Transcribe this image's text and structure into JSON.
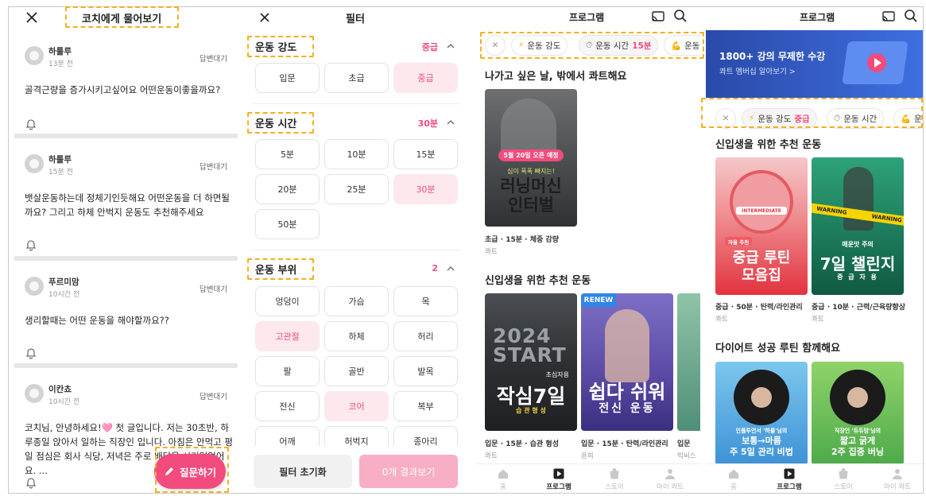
{
  "panel1": {
    "title": "코치에게 물어보기",
    "questions": [
      {
        "name": "하룰루",
        "time": "13분 전",
        "status": "답변대기",
        "text": "골격근량을 증가시키고싶어요 어떤운동이좋을까요?"
      },
      {
        "name": "하룰루",
        "time": "15분 전",
        "status": "답변대기",
        "text": "뱃살운동하는데 정체기인듯해요 어떤운동을 더 하면될까요? 그리고 하체 안벅지 운동도 추천해주세요"
      },
      {
        "name": "푸르미맘",
        "time": "10시간 전",
        "status": "답변대기",
        "text": "생리할때는 어떤 운동을 해야할까요??"
      },
      {
        "name": "이칸쵸",
        "time": "10시간 전",
        "status": "답변대기",
        "text": "코치님, 안녕하세요!🩷 첫 글입니다. 저는 30초반, 하루종일 앉아서 일하는 직장인 입니다. 아침은 안먹고 평일 점심은 회사 식당, 저녁은 주로 배달을 시켜먹었어요. ..."
      }
    ],
    "ask_button": "질문하기"
  },
  "panel2": {
    "title": "필터",
    "sections": [
      {
        "title": "운동 강도",
        "value": "중급",
        "options": [
          "입문",
          "초급",
          "중급"
        ],
        "selected": [
          "중급"
        ]
      },
      {
        "title": "운동 시간",
        "value": "30분",
        "options": [
          "5분",
          "10분",
          "15분",
          "20분",
          "25분",
          "30분",
          "50분"
        ],
        "selected": [
          "30분"
        ]
      },
      {
        "title": "운동 부위",
        "value": "2",
        "options": [
          "엉덩이",
          "가슴",
          "목",
          "고관절",
          "하체",
          "허리",
          "팔",
          "골반",
          "발목",
          "전신",
          "코어",
          "복부",
          "어깨",
          "허벅지",
          "종아리"
        ],
        "selected": [
          "고관절",
          "코어"
        ]
      }
    ],
    "reset_button": "필터 초기화",
    "result_button": "0개 결과보기"
  },
  "panel3": {
    "title": "프로그램",
    "pills": [
      {
        "icon": "lightning-icon",
        "label": "운동 강도",
        "value": ""
      },
      {
        "icon": "timer-icon",
        "label": "운동 시간",
        "value": "15분"
      },
      {
        "icon": "muscle-icon",
        "label": "운동",
        "value": ""
      }
    ],
    "section1": {
      "title": "나가고 싶은 날, 밖에서 콰트해요",
      "card": {
        "badge": "5월 20일 오픈 예정",
        "kicker": "심이 폭폭 빠지는!",
        "big": "러닝머신\n인터벌",
        "caption": "초급 · 15분 · 체중 감량",
        "sub": "콰트"
      }
    },
    "section2": {
      "title": "신입생을 위한 추천 운동",
      "cards": [
        {
          "top": "2024\nSTART",
          "kicker": "초심자용",
          "big": "작심7일",
          "small": "습 관 형 성",
          "caption": "입문 · 15분 · 습관 형성",
          "sub": "콰트"
        },
        {
          "badge": "RENEW",
          "big": "쉽다 쉬워",
          "small": "전신 운동",
          "caption": "입문 · 15분 · 탄력/라인관리",
          "sub": "윤희"
        },
        {
          "caption": "입문",
          "sub": "빅씨스"
        }
      ]
    },
    "nav": [
      "홈",
      "프로그램",
      "스토어",
      "마이 콰트"
    ]
  },
  "panel4": {
    "title": "프로그램",
    "banner": {
      "title": "1800+ 강의 무제한 수강",
      "subtitle": "콰트 멤버십 알아보기 >"
    },
    "pills": [
      {
        "icon": "lightning-icon",
        "label": "운동 강도",
        "value": "중급"
      },
      {
        "icon": "timer-icon",
        "label": "운동 시간",
        "value": ""
      },
      {
        "icon": "muscle-icon",
        "label": "운",
        "value": ""
      }
    ],
    "section1": {
      "title": "신입생을 위한 추천 운동",
      "cards": [
        {
          "gauge_label": "INTERMEDIATE",
          "tag": "자율 추천",
          "big": "중급 루틴\n모음집",
          "caption": "중급 · 50분 · 탄력/라인관리",
          "sub": "콰트"
        },
        {
          "tape": "WARNING",
          "kicker": "매운맛 주의",
          "big": "7일 챌린지",
          "small": "중 급 자 용",
          "caption": "중급 · 10분 · 근력/근육량향상",
          "sub": "콰트"
        }
      ]
    },
    "section2": {
      "title": "다이어트 성공 루틴 함께해요",
      "cards": [
        {
          "kicker": "인플루언서 '하룰'님의",
          "big": "보통→마름\n주 5일 관리 비법"
        },
        {
          "kicker": "직장인 '듀듀맘'님의",
          "big": "짧고 굵게\n2주 집중 버닝"
        }
      ]
    },
    "nav": [
      "홈",
      "프로그램",
      "스토어",
      "마이 콰트"
    ]
  }
}
